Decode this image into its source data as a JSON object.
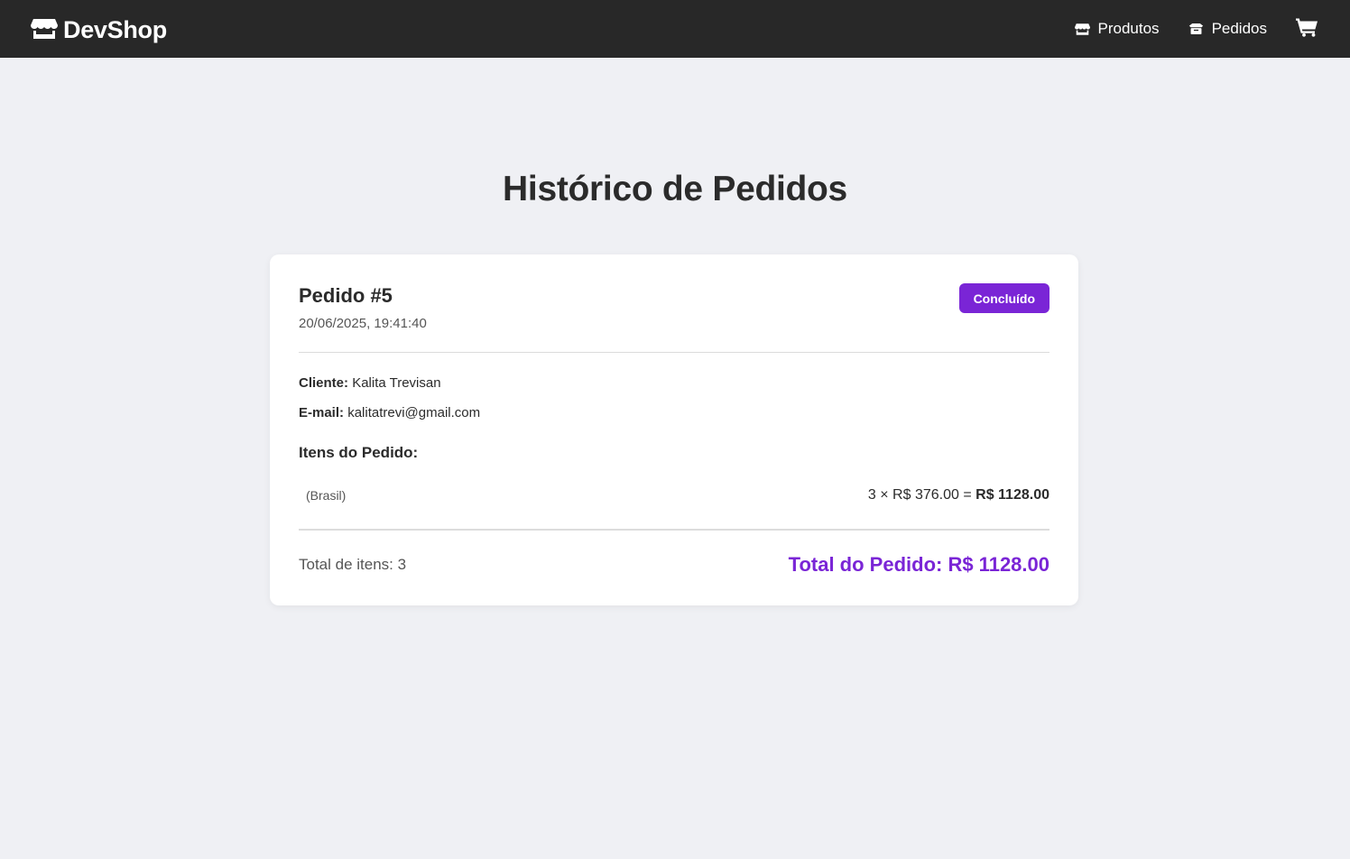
{
  "navbar": {
    "brand": "DevShop",
    "brand_icon": "store-icon",
    "links": [
      {
        "label": "Produtos",
        "icon": "store-icon"
      },
      {
        "label": "Pedidos",
        "icon": "box-icon"
      }
    ],
    "cart_icon": "cart-icon",
    "background": "#282828"
  },
  "page": {
    "title": "Histórico de Pedidos",
    "background": "#eff0f4"
  },
  "order": {
    "id_label": "Pedido #5",
    "date": "20/06/2025, 19:41:40",
    "status": "Concluído",
    "status_color": "#7a25d6",
    "customer_label": "Cliente:",
    "customer_name": "Kalita Trevisan",
    "email_label": "E-mail:",
    "email": "kalitatrevi@gmail.com",
    "items_heading": "Itens do Pedido:",
    "items": [
      {
        "name": "(Brasil)",
        "calc": "3 × R$ 376.00 =",
        "subtotal": "R$ 1128.00"
      }
    ],
    "total_items": "Total de itens: 3",
    "total": "Total do Pedido: R$ 1128.00",
    "accent": "#7a25d6"
  }
}
